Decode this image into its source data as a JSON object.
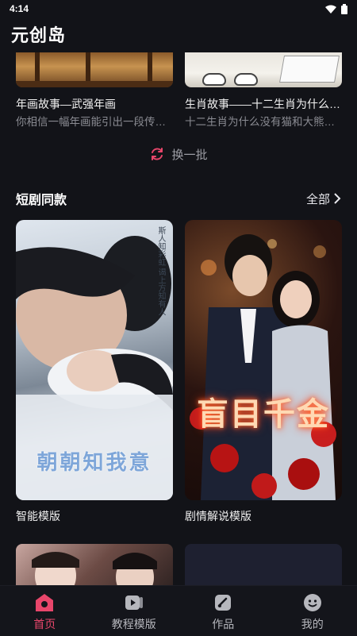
{
  "status_bar": {
    "time": "4:14"
  },
  "header": {
    "title": "元创岛"
  },
  "top_cards": [
    {
      "title": "年画故事—武强年画",
      "desc": "你相信一幅年画能引出一段传奇故事吗"
    },
    {
      "title": "生肖故事——十二生肖为什么没有猫",
      "desc": "十二生肖为什么没有猫和大熊猫呢"
    }
  ],
  "refresh": {
    "label": "换一批"
  },
  "section": {
    "title": "短剧同款",
    "see_all": "全部"
  },
  "posters": [
    {
      "title_art": "朝朝知我意",
      "vertical_text": "斯人知彩虹 谒上方知有人",
      "label": "智能模版"
    },
    {
      "title_art": "盲目千金",
      "label": "剧情解说模版"
    }
  ],
  "tabs": [
    {
      "label": "首页",
      "icon": "home-icon",
      "active": true
    },
    {
      "label": "教程模版",
      "icon": "video-tutorial-icon",
      "active": false
    },
    {
      "label": "作品",
      "icon": "works-icon",
      "active": false
    },
    {
      "label": "我的",
      "icon": "profile-icon",
      "active": false
    }
  ],
  "colors": {
    "accent": "#e8466b",
    "background": "#121318"
  }
}
